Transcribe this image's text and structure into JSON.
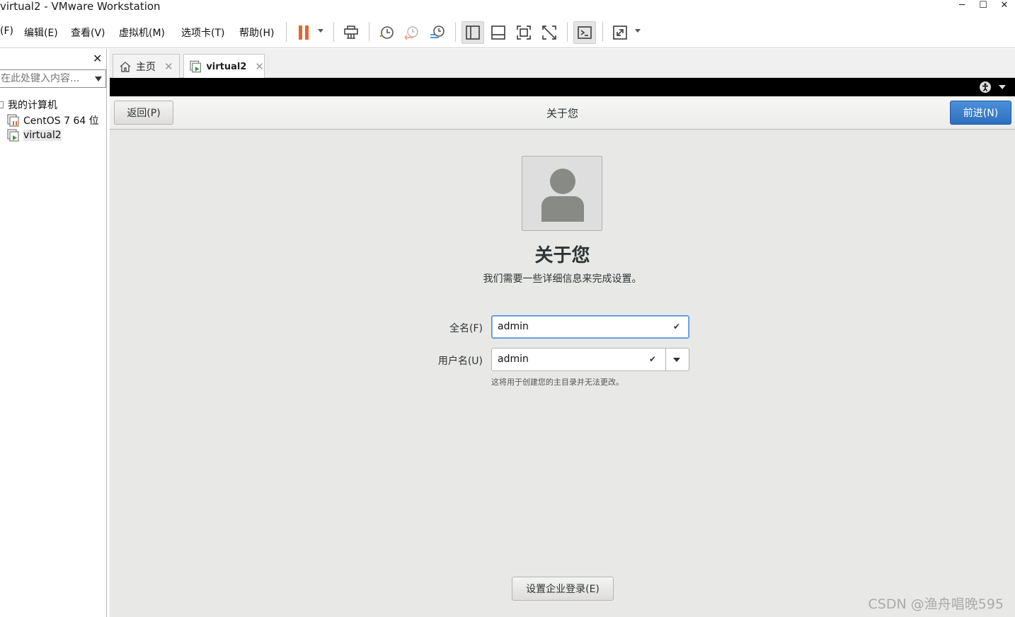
{
  "window": {
    "title": "virtual2 - VMware Workstation",
    "minimize_glyph": "─",
    "maximize_glyph": "☐",
    "close_glyph": "✕"
  },
  "menu": {
    "items": [
      "(F)",
      "编辑(E)",
      "查看(V)",
      "虚拟机(M)",
      "选项卡(T)",
      "帮助(H)"
    ]
  },
  "toolbar": {
    "icons": [
      "pause-icon",
      "send-ctrl-alt-del-icon",
      "snapshot-icon",
      "revert-snapshot-icon",
      "snapshot-manager-icon",
      "library-view-icon",
      "thumbnail-bar-icon",
      "fullscreen-icon",
      "unity-icon",
      "console-icon",
      "stretch-icon"
    ],
    "accent": "#e4672a"
  },
  "sidebar": {
    "close_glyph": "✕",
    "search_placeholder": "在此处键入内容...",
    "tree": {
      "root": "我的计算机",
      "items": [
        "CentOS 7 64 位",
        "virtual2"
      ]
    }
  },
  "tabs": [
    {
      "label": "主页",
      "close": "✕"
    },
    {
      "label": "virtual2",
      "close": "✕"
    }
  ],
  "guest": {
    "accessibility_icon": "accessibility-icon",
    "header": {
      "back_label": "返回(P)",
      "title": "关于您",
      "next_label": "前进(N)"
    },
    "heading": "关于您",
    "subtitle": "我们需要一些详细信息来完成设置。",
    "fullname": {
      "label": "全名(F)",
      "value": "admin",
      "check": "✔"
    },
    "username": {
      "label": "用户名(U)",
      "value": "admin",
      "check": "✔"
    },
    "hint": "这将用于创建您的主目录并无法更改。",
    "enterprise_label": "设置企业登录(E)",
    "primary_color": "#3a7fcf"
  },
  "watermark": "CSDN @渔舟唱晚595"
}
